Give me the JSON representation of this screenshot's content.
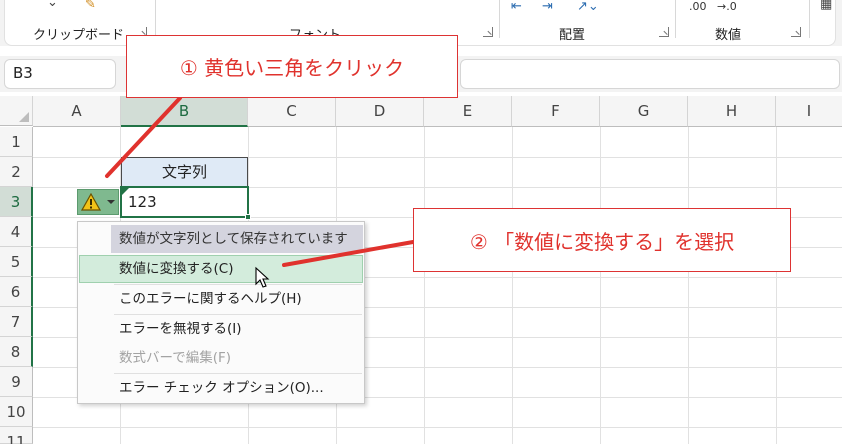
{
  "ribbon": {
    "groups": [
      {
        "label": "クリップボード"
      },
      {
        "label": "フォント"
      },
      {
        "label": "配置"
      },
      {
        "label": "数値"
      }
    ],
    "number_format_labels": [
      ".00",
      "→.0"
    ]
  },
  "namebox": {
    "value": "B3"
  },
  "columns": [
    "A",
    "B",
    "C",
    "D",
    "E",
    "F",
    "G",
    "H",
    "I"
  ],
  "rows": [
    "1",
    "2",
    "3",
    "4",
    "5",
    "6",
    "7",
    "8",
    "9",
    "10",
    "11"
  ],
  "cells": {
    "B2": "文字列",
    "B3": "123"
  },
  "error_menu": {
    "title": "数値が文字列として保存されています",
    "items": [
      {
        "label": "数値に変換する(C)",
        "state": "highlighted"
      },
      {
        "label": "このエラーに関するヘルプ(H)",
        "state": "normal"
      },
      {
        "label": "エラーを無視する(I)",
        "state": "normal"
      },
      {
        "label": "数式バーで編集(F)",
        "state": "disabled"
      },
      {
        "label": "エラー チェック オプション(O)...",
        "state": "normal"
      }
    ]
  },
  "callouts": {
    "step1": "① 黄色い三角をクリック",
    "step2": "② 「数値に変換する」を選択"
  },
  "colors": {
    "accent_green": "#217346",
    "callout_red": "#e0322d",
    "header_cell_fill": "#dfeaf6",
    "menu_highlight": "#d3ecdc"
  }
}
